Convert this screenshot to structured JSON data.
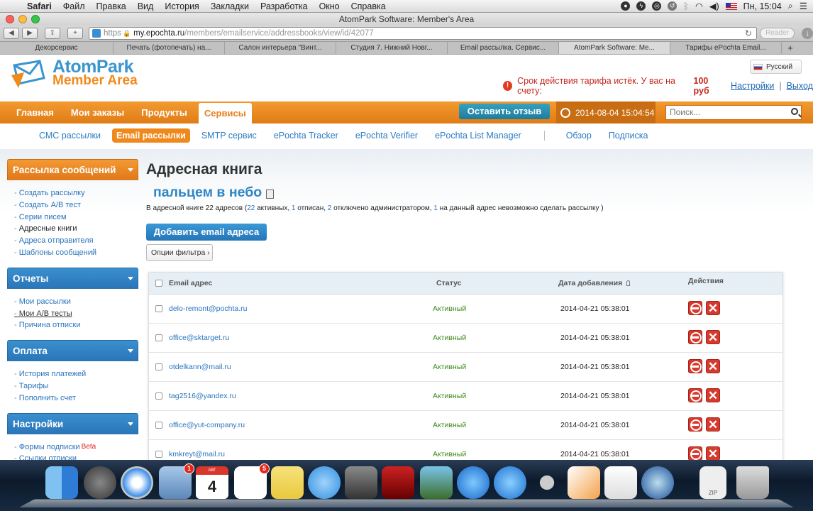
{
  "menubar": {
    "items": [
      "Safari",
      "Файл",
      "Правка",
      "Вид",
      "История",
      "Закладки",
      "Разработка",
      "Окно",
      "Справка"
    ],
    "clock": "Пн, 15:04"
  },
  "window": {
    "title": "AtomPark Software: Member's Area"
  },
  "toolbar": {
    "url_scheme": "https",
    "url_host": "my.epochta.ru",
    "url_path": "/members/emailservice/addressbooks/view/id/42077",
    "reader_label": "Reader"
  },
  "tabs": [
    "Декорсервис",
    "Печать (фотопечать) на...",
    "Салон интерьера \"Винт...",
    "Студия 7. Нижний Новг...",
    "Email рассылка. Сервис...",
    "AtomPark Software: Me...",
    "Тарифы ePochta Email..."
  ],
  "header": {
    "logo_line1": "AtomPark",
    "logo_line2": "Member Area",
    "language": "Русский",
    "notice_text": "Срок действия тарифа истёк. У вас на счету:",
    "notice_amount": "100 руб",
    "settings_link": "Настройки",
    "separator": "|",
    "logout_link": "Выход"
  },
  "mainnav": {
    "items": [
      "Главная",
      "Мои заказы",
      "Продукты",
      "Сервисы"
    ],
    "feedback_button": "Оставить отзыв",
    "datetime": "2014-08-04 15:04:54",
    "search_placeholder": "Поиск..."
  },
  "subnav": {
    "items": [
      "СМС рассылки",
      "Email рассылки",
      "SMTP сервис",
      "ePochta Tracker",
      "ePochta Verifier",
      "ePochta List Manager"
    ],
    "right_items": [
      "Обзор",
      "Подписка"
    ]
  },
  "sidebar": {
    "sections": [
      {
        "title": "Рассылка сообщений",
        "items": [
          "Создать рассылку",
          "Создать А/В тест",
          "Серии писем",
          "Адресные книги",
          "Адреса отправителя",
          "Шаблоны сообщений"
        ]
      },
      {
        "title": "Отчеты",
        "items": [
          "Мои рассылки",
          "Мои А/В тесты",
          "Причина отписки"
        ]
      },
      {
        "title": "Оплата",
        "items": [
          "История платежей",
          "Тарифы",
          "Пополнить счет"
        ]
      },
      {
        "title": "Настройки",
        "items": [
          "Формы подписки",
          "Ссылки отписки"
        ],
        "beta_label": "Beta"
      }
    ]
  },
  "main": {
    "title": "Адресная книга",
    "book_name": "пальцем в небо",
    "summary": {
      "p1": "В адресной книге 22 адресов (",
      "active": "22",
      "p2": " активных, ",
      "unsub": "1",
      "p3": " отписан, ",
      "disabled": "2",
      "p4": " отключено администратором, ",
      "undeliverable": "1",
      "p5": " на данный адрес невозможно сделать рассылку )"
    },
    "add_button": "Добавить email адреса",
    "filter_button": "Опции фильтра ›"
  },
  "table": {
    "headers": {
      "email": "Email адрес",
      "status": "Статус",
      "date": "Дата добавления",
      "actions": "Действия"
    },
    "rows": [
      {
        "email": "delo-remont@pochta.ru",
        "status": "Активный",
        "date": "2014-04-21 05:38:01"
      },
      {
        "email": "office@sktarget.ru",
        "status": "Активный",
        "date": "2014-04-21 05:38:01"
      },
      {
        "email": "otdelkann@mail.ru",
        "status": "Активный",
        "date": "2014-04-21 05:38:01"
      },
      {
        "email": "tag2516@yandex.ru",
        "status": "Активный",
        "date": "2014-04-21 05:38:01"
      },
      {
        "email": "office@yut-company.ru",
        "status": "Активный",
        "date": "2014-04-21 05:38:01"
      },
      {
        "email": "kmkreyt@mail.ru",
        "status": "Активный",
        "date": "2014-04-21 05:38:01"
      }
    ]
  },
  "dock": {
    "mail_badge": "1",
    "reminders_badge": "5",
    "calendar_month": "АВГ",
    "calendar_day": "4",
    "zip_label": "ZIP"
  }
}
